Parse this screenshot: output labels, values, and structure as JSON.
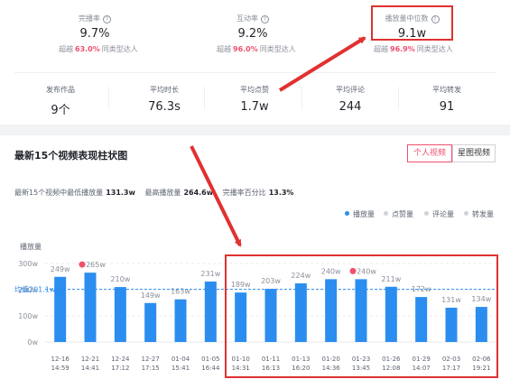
{
  "stats": [
    {
      "label": "完播率",
      "value": "9.7%",
      "sub_prefix": "超越",
      "pct": "63.0%",
      "sub_suffix": "同类型达人"
    },
    {
      "label": "互动率",
      "value": "9.2%",
      "sub_prefix": "超越",
      "pct": "96.0%",
      "sub_suffix": "同类型达人"
    },
    {
      "label": "播放量中位数",
      "value": "9.1w",
      "sub_prefix": "超越",
      "pct": "96.9%",
      "sub_suffix": "同类型达人"
    }
  ],
  "metrics": [
    {
      "label": "发布作品",
      "value": "9个"
    },
    {
      "label": "平均时长",
      "value": "76.3s"
    },
    {
      "label": "平均点赞",
      "value": "1.7w"
    },
    {
      "label": "平均评论",
      "value": "244"
    },
    {
      "label": "平均转发",
      "value": "91"
    }
  ],
  "chart_section": {
    "title": "最新15个视频表现柱状图",
    "tabs": [
      "个人视频",
      "星图视频"
    ],
    "summary": {
      "min_label": "最新15个视频中最低播放量",
      "min_value": "131.3w",
      "max_label": "最高播放量",
      "max_value": "264.6w",
      "pct_label": "完播率百分比",
      "pct_value": "13.3%"
    }
  },
  "legend": [
    {
      "name": "播放量",
      "color": "#2b8def"
    },
    {
      "name": "点赞量",
      "color": "#cfd3da"
    },
    {
      "name": "评论量",
      "color": "#cfd3da"
    },
    {
      "name": "转发量",
      "color": "#cfd3da"
    }
  ],
  "chart_data": {
    "type": "bar",
    "ylabel": "播放量",
    "ylim": [
      0,
      300
    ],
    "yticks": [
      0,
      100,
      200,
      300
    ],
    "ytick_labels": [
      "0w",
      "100w",
      "200w",
      "300w"
    ],
    "average": {
      "value": 201.1,
      "label": "均值201.1w"
    },
    "categories": [
      [
        "12-16",
        "14:59"
      ],
      [
        "12-21",
        "14:41"
      ],
      [
        "12-24",
        "17:12"
      ],
      [
        "12-27",
        "17:15"
      ],
      [
        "01-04",
        "15:41"
      ],
      [
        "01-05",
        "16:44"
      ],
      [
        "01-10",
        "14:31"
      ],
      [
        "01-11",
        "16:13"
      ],
      [
        "01-13",
        "16:20"
      ],
      [
        "01-20",
        "14:36"
      ],
      [
        "01-23",
        "13:45"
      ],
      [
        "01-26",
        "12:08"
      ],
      [
        "01-29",
        "14:07"
      ],
      [
        "02-03",
        "17:17"
      ],
      [
        "02-06",
        "19:21"
      ]
    ],
    "values": [
      249,
      265,
      210,
      149,
      163,
      231,
      189,
      203,
      224,
      240,
      240,
      211,
      172,
      131,
      134
    ],
    "value_labels": [
      "249w",
      "265w",
      "210w",
      "149w",
      "163w",
      "231w",
      "189w",
      "203w",
      "224w",
      "240w",
      "240w",
      "211w",
      "172w",
      "131w",
      "134w"
    ],
    "highlight_indices": [
      1,
      10
    ],
    "bar_color": "#2b8def"
  },
  "colors": {
    "accent": "#f0506e",
    "annotation": "#e03131",
    "bar": "#2b8def",
    "average_line": "#2b8def"
  }
}
